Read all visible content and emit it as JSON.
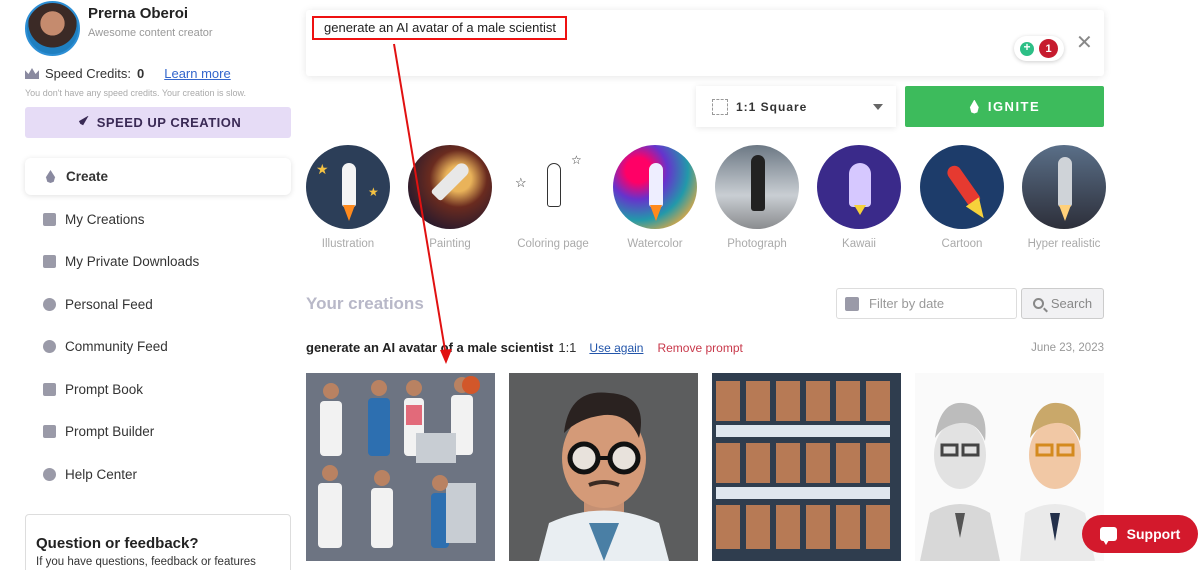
{
  "profile": {
    "name": "Prerna Oberoi",
    "subtitle": "Awesome content creator",
    "avatar_icon": "user-avatar"
  },
  "credits": {
    "label": "Speed Credits:",
    "count": "0",
    "learn_more": "Learn more",
    "note": "You don't have any speed credits. Your creation is slow."
  },
  "speed_button": {
    "label": "SPEED UP CREATION",
    "icon": "rocket-icon"
  },
  "nav": {
    "items": [
      {
        "label": "Create",
        "icon": "flame-icon",
        "active": true
      },
      {
        "label": "My Creations",
        "icon": "gallery-icon"
      },
      {
        "label": "My Private Downloads",
        "icon": "download-icon"
      },
      {
        "label": "Personal Feed",
        "icon": "user-circle-icon"
      },
      {
        "label": "Community Feed",
        "icon": "globe-icon"
      },
      {
        "label": "Prompt Book",
        "icon": "book-icon"
      },
      {
        "label": "Prompt Builder",
        "icon": "tools-icon"
      },
      {
        "label": "Help Center",
        "icon": "lifebuoy-icon"
      }
    ]
  },
  "feedback": {
    "title": "Question or feedback?",
    "text": "If you have questions, feedback or features"
  },
  "prompt": {
    "text": "generate an AI avatar of a male scientist",
    "idea_count": "1"
  },
  "ratio": {
    "label": "1:1 Square"
  },
  "ignite": {
    "label": "IGNITE"
  },
  "styles": [
    {
      "label": "Illustration"
    },
    {
      "label": "Painting"
    },
    {
      "label": "Coloring page"
    },
    {
      "label": "Watercolor"
    },
    {
      "label": "Photograph"
    },
    {
      "label": "Kawaii"
    },
    {
      "label": "Cartoon"
    },
    {
      "label": "Hyper realistic"
    }
  ],
  "creations": {
    "title": "Your creations",
    "filter_placeholder": "Filter by date",
    "search_label": "Search"
  },
  "prompt_row": {
    "title": "generate an AI avatar of a male scientist",
    "ratio": "1:1",
    "use_again": "Use again",
    "remove": "Remove prompt",
    "date": "June 23, 2023"
  },
  "support": {
    "label": "Support"
  },
  "colors": {
    "accent_green": "#3dbb5c",
    "speed_bg": "#e6dcf6",
    "annotation_red": "#e11111",
    "support_red": "#d3192c"
  }
}
